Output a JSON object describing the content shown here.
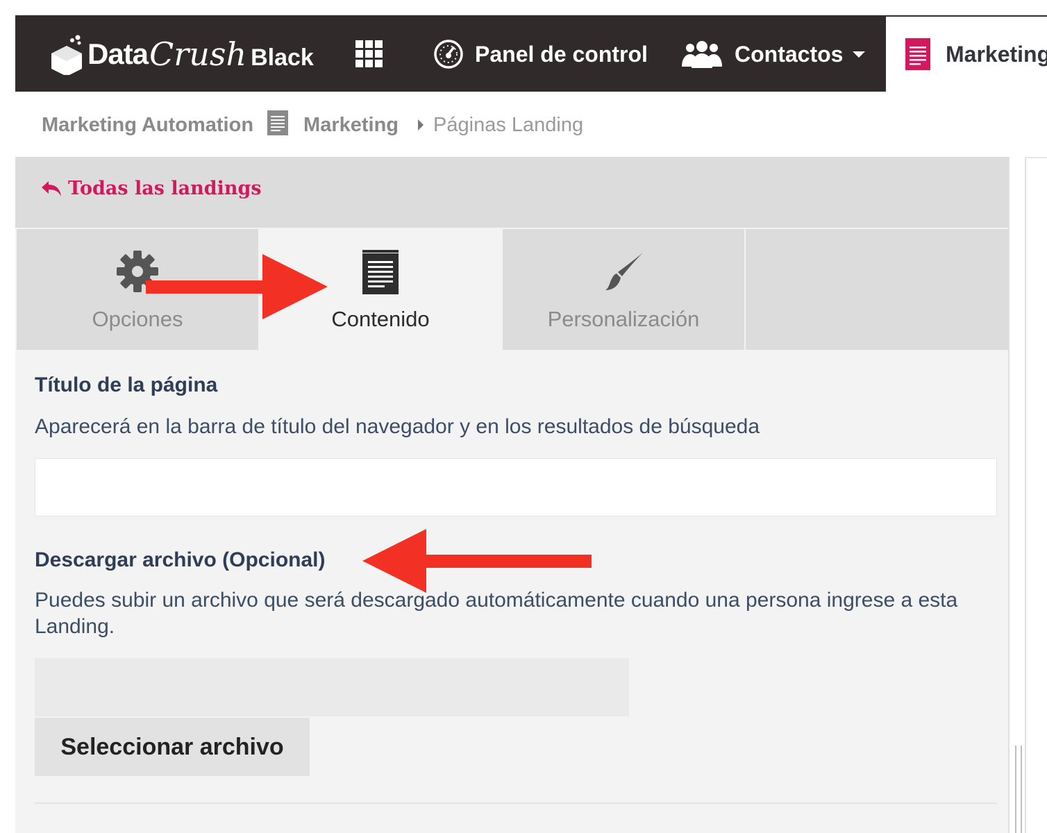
{
  "brand": {
    "logo_data": "Data",
    "logo_crush": "Crush",
    "logo_black": "Black",
    "logo_color": "#ffffff"
  },
  "topnav": {
    "background": "#302a2b",
    "apps_icon": "grid-icon",
    "items": [
      {
        "label": "Panel de control",
        "icon": "dashboard-icon"
      },
      {
        "label": "Contactos",
        "icon": "users-icon"
      },
      {
        "label": "Marketing",
        "icon": "document-icon",
        "active": true
      }
    ]
  },
  "breadcrumb": {
    "root": "Marketing Automation",
    "section": "Marketing",
    "current": "Páginas Landing"
  },
  "back_link": {
    "label": "Todas las landings",
    "icon": "reply-arrow-icon",
    "color": "#d2195e"
  },
  "tabs": [
    {
      "label": "Opciones",
      "icon": "gear-icon",
      "active": false
    },
    {
      "label": "Contenido",
      "icon": "document-icon",
      "active": true
    },
    {
      "label": "Personalización",
      "icon": "paintbrush-icon",
      "active": false
    }
  ],
  "page_title_field": {
    "label": "Título de la página",
    "help": "Aparecerá en la barra de título del navegador y en los resultados de búsqueda",
    "value": ""
  },
  "download_field": {
    "label": "Descargar archivo (Opcional)",
    "help": "Puedes subir un archivo que será descargado automáticamente cuando una persona ingrese a esta Landing.",
    "file_name": "",
    "button_label": "Seleccionar archivo"
  },
  "annotation_color": "#f23024",
  "accent_color": "#d2195e"
}
